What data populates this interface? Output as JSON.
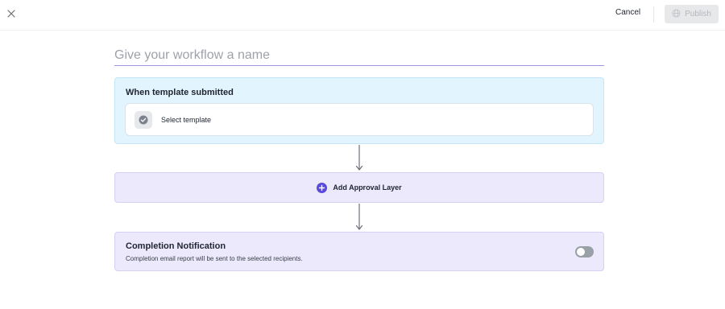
{
  "header": {
    "close_icon": "close-icon",
    "cancel_label": "Cancel",
    "publish_label": "Publish",
    "publish_icon": "globe-icon"
  },
  "workflow": {
    "name_value": "",
    "name_placeholder": "Give your workflow a name"
  },
  "trigger": {
    "title": "When template submitted",
    "select_label": "Select template",
    "select_icon": "check-circle-icon"
  },
  "approval": {
    "label": "Add Approval Layer",
    "icon": "plus-circle-icon"
  },
  "notification": {
    "title": "Completion Notification",
    "description": "Completion email report will be sent to the selected recipients.",
    "enabled": false
  },
  "colors": {
    "accent": "#5a4ad7",
    "trigger_bg": "#e2f4fd",
    "step_bg": "#ebe9fb",
    "publish_disabled_bg": "#e7e8ea"
  }
}
